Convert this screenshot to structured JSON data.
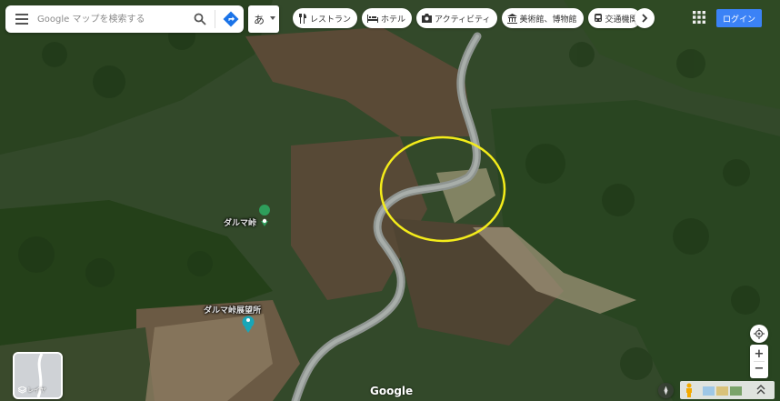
{
  "search": {
    "placeholder": "Google マップを検索する"
  },
  "ime": {
    "label": "あ"
  },
  "categories": [
    {
      "label": "レストラン",
      "icon": "fork-knife-icon"
    },
    {
      "label": "ホテル",
      "icon": "bed-icon"
    },
    {
      "label": "アクティビティ",
      "icon": "camera-icon"
    },
    {
      "label": "美術館、博物館",
      "icon": "museum-icon"
    },
    {
      "label": "交通機関",
      "icon": "train-icon"
    }
  ],
  "header": {
    "login_label": "ログイン"
  },
  "places": [
    {
      "name": "ダルマ峠",
      "type": "landmark",
      "color": "#2e9e5b"
    },
    {
      "name": "ダルマ峠展望所",
      "type": "viewpoint",
      "color": "#19a6b8"
    }
  ],
  "layer_toggle": {
    "label": "レイヤ"
  },
  "footer": {
    "logo": "Google"
  },
  "map": {
    "view": "satellite",
    "highlight_color": "#f4ec1a"
  },
  "colors": {
    "accent": "#3b82f6"
  }
}
